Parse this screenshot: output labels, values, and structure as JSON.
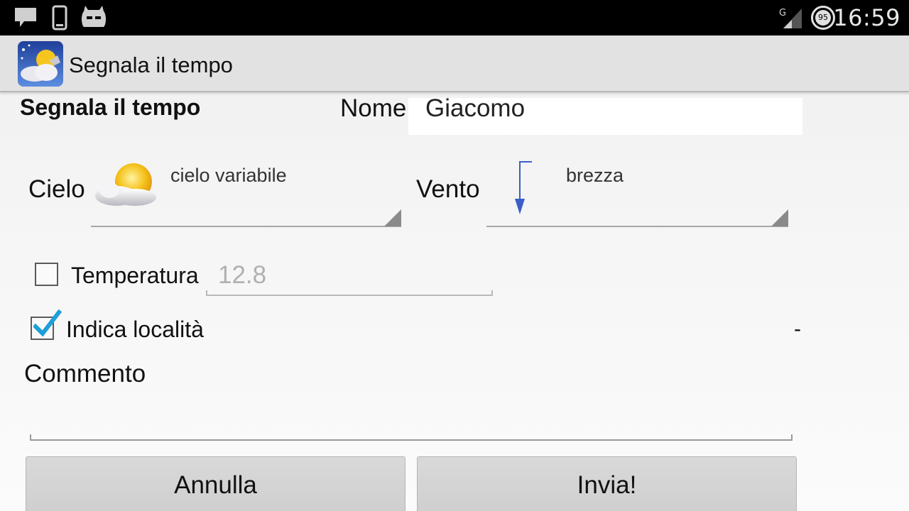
{
  "status_bar": {
    "time": "16:59",
    "battery_level": "95",
    "network_type": "G",
    "icons": [
      "chat-notification-icon",
      "phone-icon",
      "cyanogen-mascot-icon",
      "signal-icon",
      "battery-icon"
    ]
  },
  "action_bar": {
    "title": "Segnala il tempo",
    "app_icon": "weather-app-icon"
  },
  "form": {
    "heading": "Segnala il tempo",
    "name_label": "Nome",
    "name_value": "Giacomo",
    "sky_label": "Cielo",
    "sky_value": "cielo variabile",
    "sky_icon": "partly-cloudy-icon",
    "wind_label": "Vento",
    "wind_value": "brezza",
    "wind_icon": "wind-arrow-down-icon",
    "temperature_label": "Temperatura",
    "temperature_checked": false,
    "temperature_placeholder": "12.8",
    "location_label": "Indica località",
    "location_checked": true,
    "location_value": "-",
    "comment_label": "Commento",
    "comment_value": ""
  },
  "buttons": {
    "cancel_label": "Annulla",
    "send_label": "Invia!"
  },
  "colors": {
    "status_bar_bg": "#000000",
    "action_bar_bg": "#e2e2e2",
    "accent_check": "#1e9fd8",
    "wind_arrow": "#3a5fc8"
  }
}
